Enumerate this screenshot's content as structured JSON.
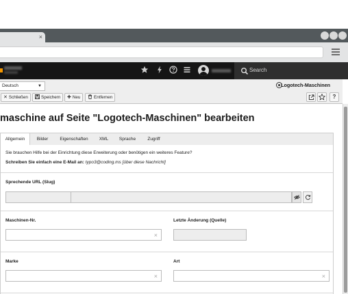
{
  "browser": {
    "tab_close": "×"
  },
  "topbar": {
    "search_placeholder": "Search"
  },
  "docheader": {
    "language": "Deutsch",
    "module_title": "Logotech-Maschinen",
    "buttons": {
      "close": "Schließen",
      "save": "Speichern",
      "new": "Neu",
      "delete": "Entfernen"
    },
    "help_button": "?"
  },
  "main": {
    "title": "maschine auf Seite \"Logotech-Maschinen\" bearbeiten",
    "tabs": [
      {
        "label": "Allgemein"
      },
      {
        "label": "Bilder"
      },
      {
        "label": "Eigenschaften"
      },
      {
        "label": "XML"
      },
      {
        "label": "Sprache"
      },
      {
        "label": "Zugriff"
      }
    ],
    "help": {
      "line1": "Sie brauchen Hilfe bei der Einrichtung diese Erweiterung oder benötigen ein weiteres Feature?",
      "line2_bold": "Schreiben Sie einfach eine E-Mail an:",
      "line2_italic": "typo3@coding.ms [über diese Nachricht]"
    },
    "fields": {
      "slug_label": "Sprechende URL (Slug)",
      "machine_nr_label": "Maschinen-Nr.",
      "last_change_label": "Letzte Änderung (Quelle)",
      "brand_label": "Marke",
      "type_label": "Art",
      "clear_symbol": "×"
    }
  }
}
